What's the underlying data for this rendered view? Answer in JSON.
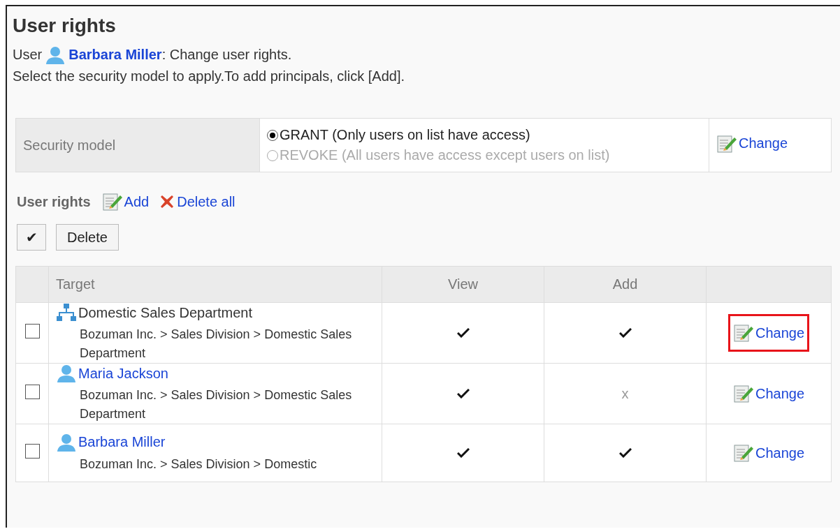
{
  "title": "User rights",
  "intro": {
    "prefix": "User",
    "user": "Barbara Miller",
    "suffix": ": Change user rights."
  },
  "instruction": "Select the security model to apply.To add principals, click [Add].",
  "security": {
    "label": "Security model",
    "options": [
      {
        "text": "GRANT (Only users on list have access)",
        "selected": true
      },
      {
        "text": "REVOKE (All users have access except users on list)",
        "selected": false
      }
    ],
    "change": "Change"
  },
  "rights_header": {
    "title": "User rights",
    "add": "Add",
    "delete_all": "Delete all"
  },
  "toolbar": {
    "toggle": "✔",
    "delete": "Delete"
  },
  "table": {
    "columns": [
      "Target",
      "View",
      "Add"
    ],
    "rows": [
      {
        "kind": "group",
        "name": "Domestic Sales Department",
        "path": "Bozuman Inc. > Sales Division > Domestic Sales Department",
        "checked": false,
        "view": {
          "allowed": true
        },
        "add": {
          "allowed": true
        },
        "change": "Change",
        "highlighted": true
      },
      {
        "kind": "user",
        "name": "Maria Jackson",
        "path": "Bozuman Inc. > Sales Division > Domestic Sales Department",
        "checked": false,
        "view": {
          "allowed": true
        },
        "add": {
          "allowed": false,
          "text": "x"
        },
        "change": "Change",
        "highlighted": false
      },
      {
        "kind": "user",
        "name": "Barbara Miller",
        "path": "Bozuman Inc. > Sales Division > Domestic",
        "checked": false,
        "view": {
          "allowed": true
        },
        "add": {
          "allowed": true
        },
        "change": "Change",
        "highlighted": false
      }
    ]
  }
}
